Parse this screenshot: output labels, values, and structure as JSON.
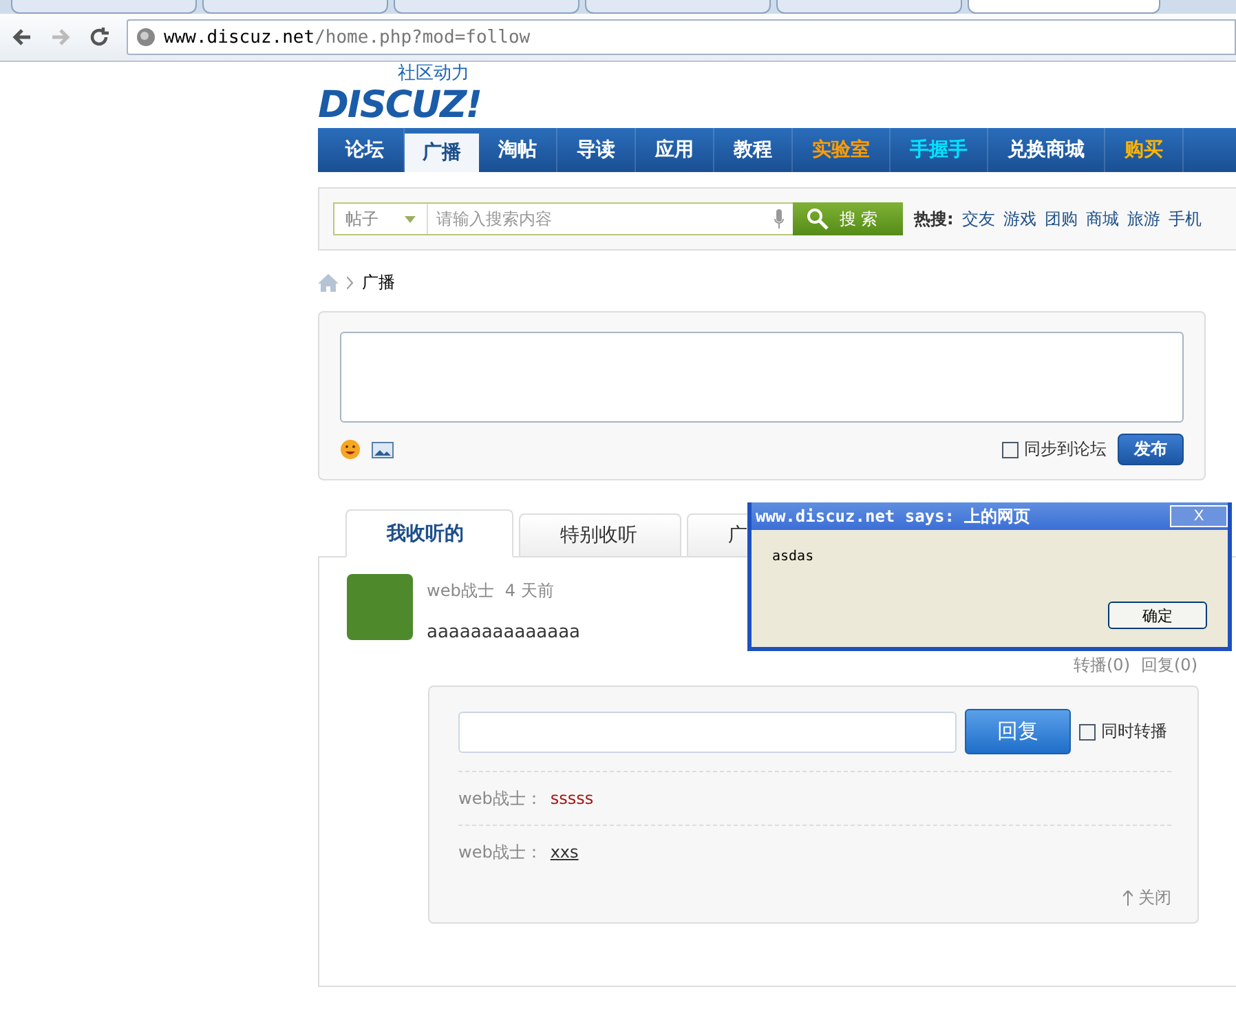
{
  "browser": {
    "tabs": [
      {
        "selected": false
      },
      {
        "selected": false
      },
      {
        "selected": false
      },
      {
        "selected": false
      },
      {
        "selected": false
      },
      {
        "selected": true
      }
    ],
    "url_host": "www.discuz.net",
    "url_path": "/home.php?mod=follow"
  },
  "logo": {
    "tagline": "社区动力",
    "name": "DISCUZ!"
  },
  "nav": [
    {
      "label": "论坛",
      "selected": false,
      "kind": "normal"
    },
    {
      "label": "广播",
      "selected": true,
      "kind": "normal"
    },
    {
      "label": "淘帖",
      "selected": false,
      "kind": "normal"
    },
    {
      "label": "导读",
      "selected": false,
      "kind": "normal"
    },
    {
      "label": "应用",
      "selected": false,
      "kind": "normal"
    },
    {
      "label": "教程",
      "selected": false,
      "kind": "normal"
    },
    {
      "label": "实验室",
      "selected": false,
      "kind": "featured"
    },
    {
      "label": "手握手",
      "selected": false,
      "kind": "partner"
    },
    {
      "label": "兑换商城",
      "selected": false,
      "kind": "normal"
    },
    {
      "label": "购买",
      "selected": false,
      "kind": "shop"
    }
  ],
  "search": {
    "type": "帖子",
    "placeholder": "请输入搜索内容",
    "button": "搜 索",
    "hot_label": "热搜:",
    "hot": [
      "交友",
      "游戏",
      "团购",
      "商城",
      "旅游",
      "手机"
    ]
  },
  "breadcrumb": "广播",
  "composer": {
    "sync_label": "同步到论坛",
    "sync_checked": false,
    "submit": "发布"
  },
  "feed_tabs": [
    {
      "label": "我收听的",
      "selected": true
    },
    {
      "label": "特别收听",
      "selected": false
    },
    {
      "label": "广",
      "selected": false
    }
  ],
  "post": {
    "author": "web战士",
    "time": "4 天前",
    "text": "aaaaaaaaaaaaaa",
    "forward": "转播(0)",
    "reply": "回复(0)",
    "reply_box": {
      "button": "回复",
      "also_forward": "同时转播",
      "also_forward_checked": false,
      "replies": [
        {
          "author": "web战士：",
          "text": "sssss",
          "kind": "plain"
        },
        {
          "author": "web战士：",
          "text": "xxs",
          "kind": "link"
        }
      ],
      "close": "关闭"
    }
  },
  "dialog": {
    "title": "www.discuz.net says: 上的网页",
    "close": "X",
    "message": "asdas",
    "ok": "确定"
  }
}
